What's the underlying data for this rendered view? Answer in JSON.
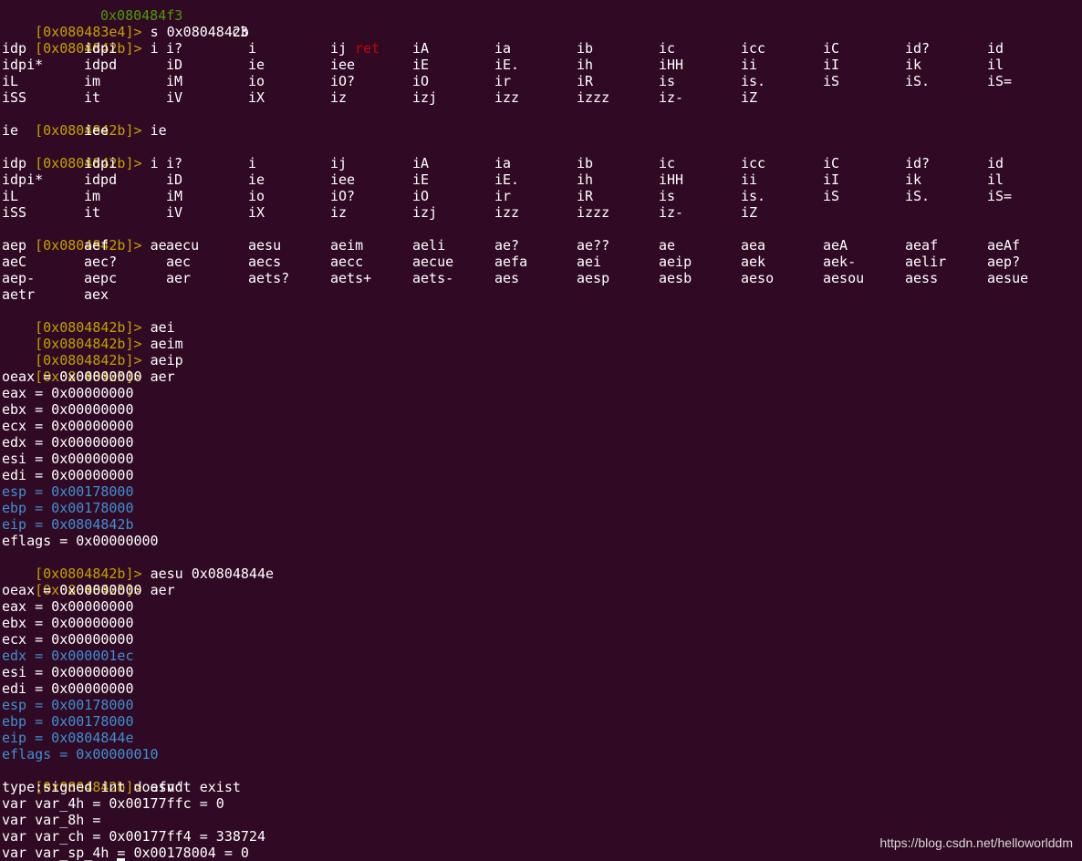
{
  "colors": {
    "background": "#300a24",
    "prompt": "#c4a000",
    "text": "#ffffff",
    "changed_register": "#3f8fd2"
  },
  "top_partial": [
    "0x080484f3",
    "c3",
    "ret"
  ],
  "prompts": {
    "p_080483e4": "[0x080483e4]> ",
    "p_0804842b": "[0x0804842b]> "
  },
  "commands": [
    "s 0x0804842b",
    "i",
    "ie",
    "i",
    "ae",
    "aei",
    "aeim",
    "aeip",
    "aer",
    "aesu 0x0804844e",
    "aer",
    "afvd"
  ],
  "i_completions": [
    [
      "idp",
      "idpi",
      "i?",
      "i",
      "ij",
      "iA",
      "ia",
      "ib",
      "ic",
      "icc",
      "iC",
      "id?",
      "id"
    ],
    [
      "idpi*",
      "idpd",
      "iD",
      "ie",
      "iee",
      "iE",
      "iE.",
      "ih",
      "iHH",
      "ii",
      "iI",
      "ik",
      "il"
    ],
    [
      "iL",
      "im",
      "iM",
      "io",
      "iO?",
      "iO",
      "ir",
      "iR",
      "is",
      "is.",
      "iS",
      "iS.",
      "iS="
    ],
    [
      "iSS",
      "it",
      "iV",
      "iX",
      "iz",
      "izj",
      "izz",
      "izzz",
      "iz-",
      "iZ"
    ]
  ],
  "ie_completions": [
    [
      "ie",
      "iee"
    ]
  ],
  "ae_completions": [
    [
      "aep",
      "aef",
      "aecu",
      "aesu",
      "aeim",
      "aeli",
      "ae?",
      "ae??",
      "ae",
      "aea",
      "aeA",
      "aeaf",
      "aeAf"
    ],
    [
      "aeC",
      "aec?",
      "aec",
      "aecs",
      "aecc",
      "aecue",
      "aefa",
      "aei",
      "aeip",
      "aek",
      "aek-",
      "aelir",
      "aep?"
    ],
    [
      "aep-",
      "aepc",
      "aer",
      "aets?",
      "aets+",
      "aets-",
      "aes",
      "aesp",
      "aesb",
      "aeso",
      "aesou",
      "aess",
      "aesue"
    ],
    [
      "aetr",
      "aex"
    ]
  ],
  "registers_1": [
    {
      "text": "oeax = 0x00000000",
      "changed": false
    },
    {
      "text": "eax = 0x00000000",
      "changed": false
    },
    {
      "text": "ebx = 0x00000000",
      "changed": false
    },
    {
      "text": "ecx = 0x00000000",
      "changed": false
    },
    {
      "text": "edx = 0x00000000",
      "changed": false
    },
    {
      "text": "esi = 0x00000000",
      "changed": false
    },
    {
      "text": "edi = 0x00000000",
      "changed": false
    },
    {
      "text": "esp = 0x00178000",
      "changed": true
    },
    {
      "text": "ebp = 0x00178000",
      "changed": true
    },
    {
      "text": "eip = 0x0804842b",
      "changed": true
    },
    {
      "text": "eflags = 0x00000000",
      "changed": false
    }
  ],
  "registers_2": [
    {
      "text": "oeax = 0x00000000",
      "changed": false
    },
    {
      "text": "eax = 0x00000000",
      "changed": false
    },
    {
      "text": "ebx = 0x00000000",
      "changed": false
    },
    {
      "text": "ecx = 0x00000000",
      "changed": false
    },
    {
      "text": "edx = 0x000001ec",
      "changed": true
    },
    {
      "text": "esi = 0x00000000",
      "changed": false
    },
    {
      "text": "edi = 0x00000000",
      "changed": false
    },
    {
      "text": "esp = 0x00178000",
      "changed": true
    },
    {
      "text": "ebp = 0x00178000",
      "changed": true
    },
    {
      "text": "eip = 0x0804844e",
      "changed": true
    },
    {
      "text": "eflags = 0x00000010",
      "changed": true
    }
  ],
  "afvd_output": [
    "type:signed int doesn't exist",
    "var var_4h = 0x00177ffc = 0",
    "var var_8h = ",
    "var var_ch = 0x00177ff4 = 338724",
    "var var_sp_4h = 0x00178004 = 0"
  ],
  "watermark": "https://blog.csdn.net/helloworlddm"
}
